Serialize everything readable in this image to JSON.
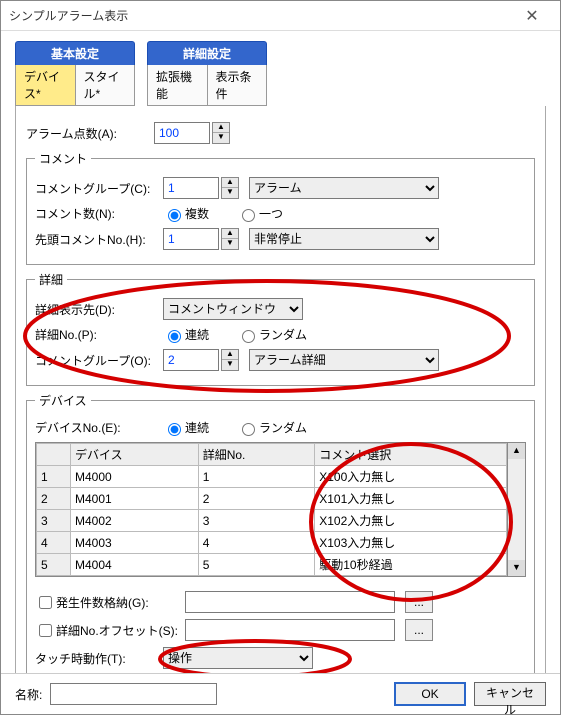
{
  "window": {
    "title": "シンプルアラーム表示"
  },
  "tabs": {
    "basic_head": "基本設定",
    "adv_head": "詳細設定",
    "device": "デバイス*",
    "style": "スタイル*",
    "ext": "拡張機能",
    "cond": "表示条件"
  },
  "alarm": {
    "label": "アラーム点数(A):",
    "value": "100"
  },
  "comment": {
    "legend": "コメント",
    "group_label": "コメントグループ(C):",
    "group_value": "1",
    "group_sel": "アラーム",
    "count_label": "コメント数(N):",
    "count_multi": "複数",
    "count_one": "一つ",
    "head_label": "先頭コメントNo.(H):",
    "head_value": "1",
    "head_sel": "非常停止"
  },
  "detail": {
    "legend": "詳細",
    "disp_label": "詳細表示先(D):",
    "disp_sel": "コメントウィンドウ",
    "no_label": "詳細No.(P):",
    "no_cont": "連続",
    "no_rand": "ランダム",
    "group_label": "コメントグループ(O):",
    "group_value": "2",
    "group_sel": "アラーム詳細"
  },
  "device": {
    "legend": "デバイス",
    "no_label": "デバイスNo.(E):",
    "no_cont": "連続",
    "no_rand": "ランダム",
    "cols": {
      "device": "デバイス",
      "detailno": "詳細No.",
      "comment": "コメント選択"
    },
    "rows": [
      {
        "idx": "1",
        "device": "M4000",
        "detailno": "1",
        "comment": "X100入力無し"
      },
      {
        "idx": "2",
        "device": "M4001",
        "detailno": "2",
        "comment": "X101入力無し"
      },
      {
        "idx": "3",
        "device": "M4002",
        "detailno": "3",
        "comment": "X102入力無し"
      },
      {
        "idx": "4",
        "device": "M4003",
        "detailno": "4",
        "comment": "X103入力無し"
      },
      {
        "idx": "5",
        "device": "M4004",
        "detailno": "5",
        "comment": "駆動10秒経過"
      }
    ],
    "store_label": "発生件数格納(G):",
    "offset_label": "詳細No.オフセット(S):",
    "touch_label": "タッチ時動作(T):",
    "touch_sel": "操作",
    "dots": "..."
  },
  "footer": {
    "name_label": "名称:",
    "ok": "OK",
    "cancel": "キャンセル"
  }
}
